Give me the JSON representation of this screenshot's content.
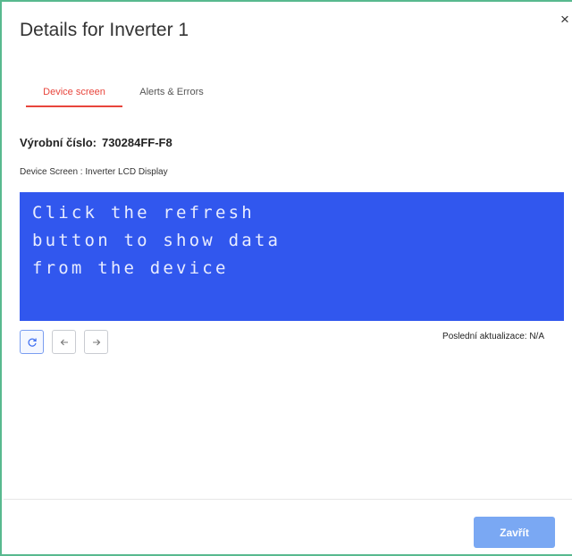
{
  "dialog": {
    "title": "Details for Inverter 1",
    "close_icon": "×"
  },
  "tabs": [
    {
      "label": "Device screen",
      "active": true
    },
    {
      "label": "Alerts & Errors",
      "active": false
    }
  ],
  "serial": {
    "label": "Výrobní číslo:",
    "value": "730284FF-F8"
  },
  "screen_label": "Device Screen : Inverter LCD Display",
  "lcd": {
    "lines": [
      "Click the refresh",
      "button to show data",
      "from the device"
    ],
    "background": "#3157ee"
  },
  "controls": {
    "refresh_icon": "refresh-icon",
    "prev_icon": "arrow-left-icon",
    "next_icon": "arrow-right-icon"
  },
  "last_update": "Poslední aktualizace: N/A",
  "footer": {
    "close_label": "Zavřít"
  },
  "colors": {
    "accent_tab": "#e8453c",
    "primary_button": "#7aa8f3",
    "frame_border": "#58b98f"
  }
}
